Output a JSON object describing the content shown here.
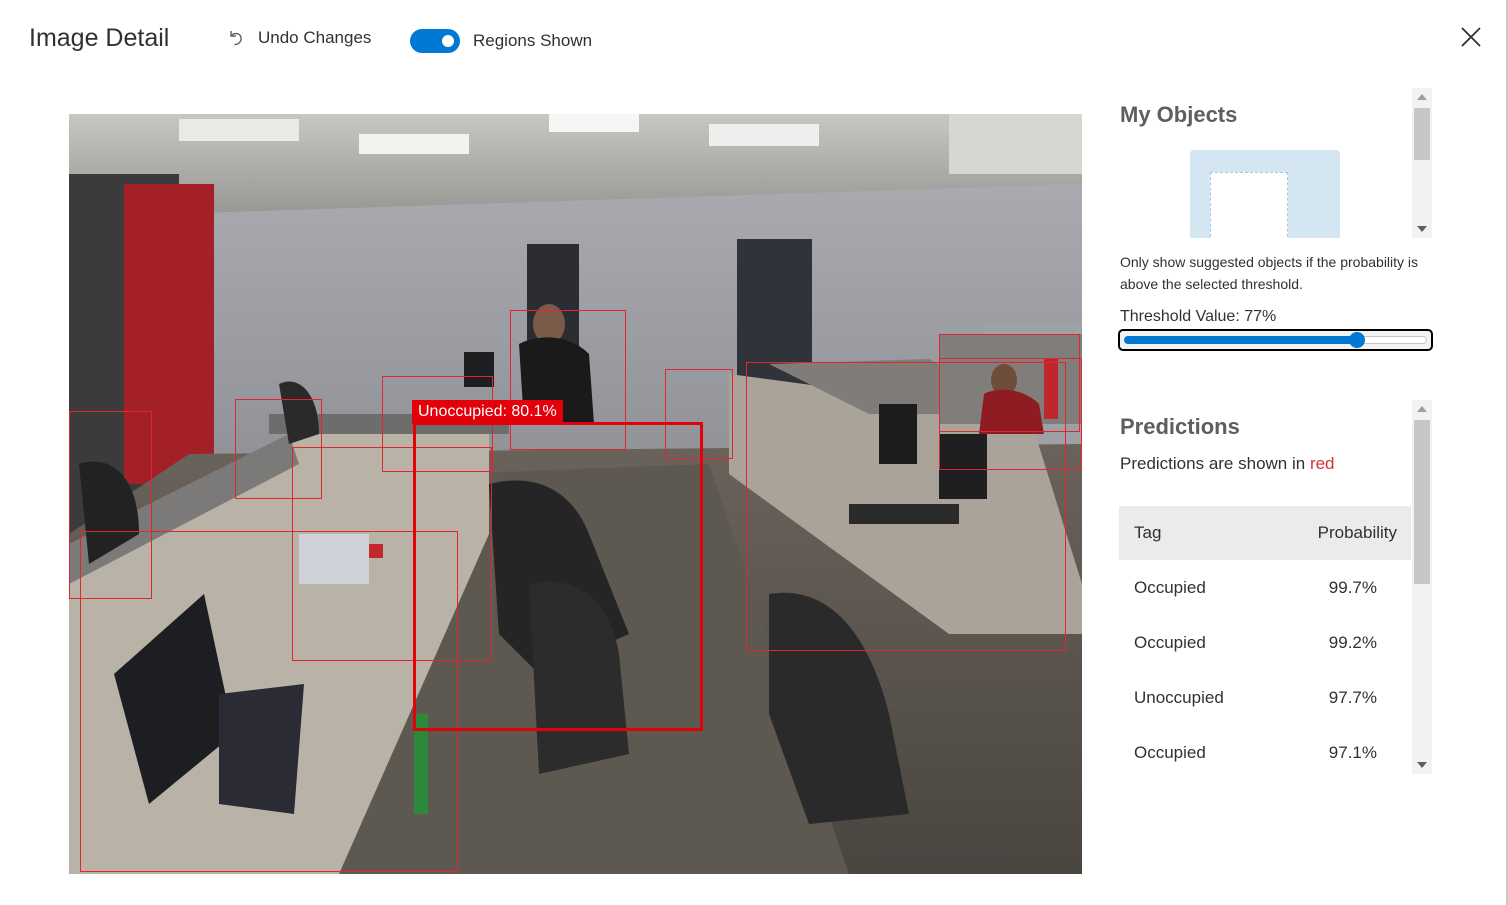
{
  "header": {
    "title": "Image Detail",
    "undo_label": "Undo Changes",
    "toggle_label": "Regions Shown",
    "toggle_on": true
  },
  "image": {
    "active_region_label": "Unoccupied: 80.1%"
  },
  "my_objects": {
    "title": "My Objects"
  },
  "threshold": {
    "hint": "Only show suggested objects if the probability is above the selected threshold.",
    "label": "Threshold Value: 77%",
    "value_percent": 77
  },
  "predictions": {
    "title": "Predictions",
    "subtitle_prefix": "Predictions are shown in ",
    "subtitle_color_word": "red",
    "columns": [
      "Tag",
      "Probability"
    ],
    "rows": [
      {
        "tag": "Occupied",
        "probability": "99.7%"
      },
      {
        "tag": "Occupied",
        "probability": "99.2%"
      },
      {
        "tag": "Unoccupied",
        "probability": "97.7%"
      },
      {
        "tag": "Occupied",
        "probability": "97.1%"
      }
    ]
  },
  "colors": {
    "accent": "#0078d4",
    "region": "#e3000b",
    "header_row": "#edebe9"
  }
}
